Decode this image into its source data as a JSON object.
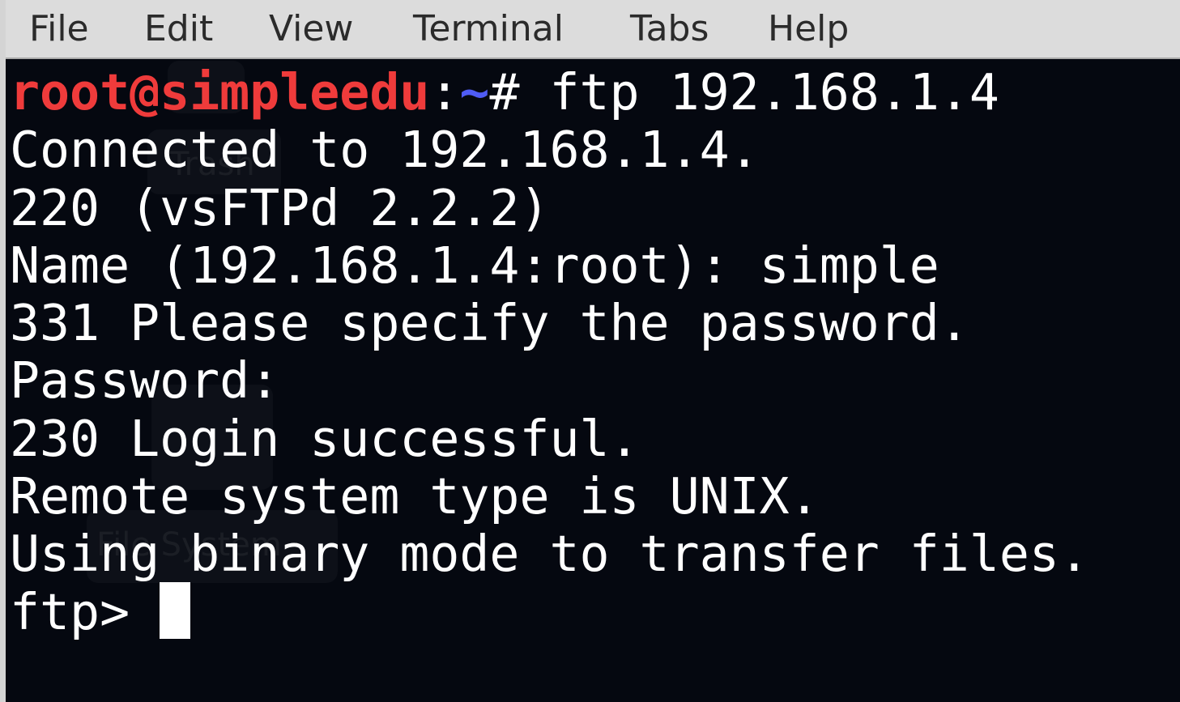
{
  "menubar": {
    "items": [
      "File",
      "Edit",
      "View",
      "Terminal",
      "Tabs",
      "Help"
    ]
  },
  "background_desktop": {
    "labels": [
      "Trash",
      "File System"
    ]
  },
  "terminal": {
    "prompt": {
      "user_host": "root@simpleedu",
      "separator": ":",
      "path": "~",
      "symbol": "# ",
      "command": "ftp 192.168.1.4"
    },
    "output": [
      "Connected to 192.168.1.4.",
      "220 (vsFTPd 2.2.2)",
      "Name (192.168.1.4:root): simple",
      "331 Please specify the password.",
      "Password:",
      "230 Login successful.",
      "Remote system type is UNIX.",
      "Using binary mode to transfer files."
    ],
    "ftp_prompt": "ftp> "
  },
  "colors": {
    "background": "#050810",
    "menubar": "#dcdcdc",
    "text": "#ffffff",
    "prompt_user": "#ef3b3b",
    "prompt_path": "#4f5cf5"
  }
}
